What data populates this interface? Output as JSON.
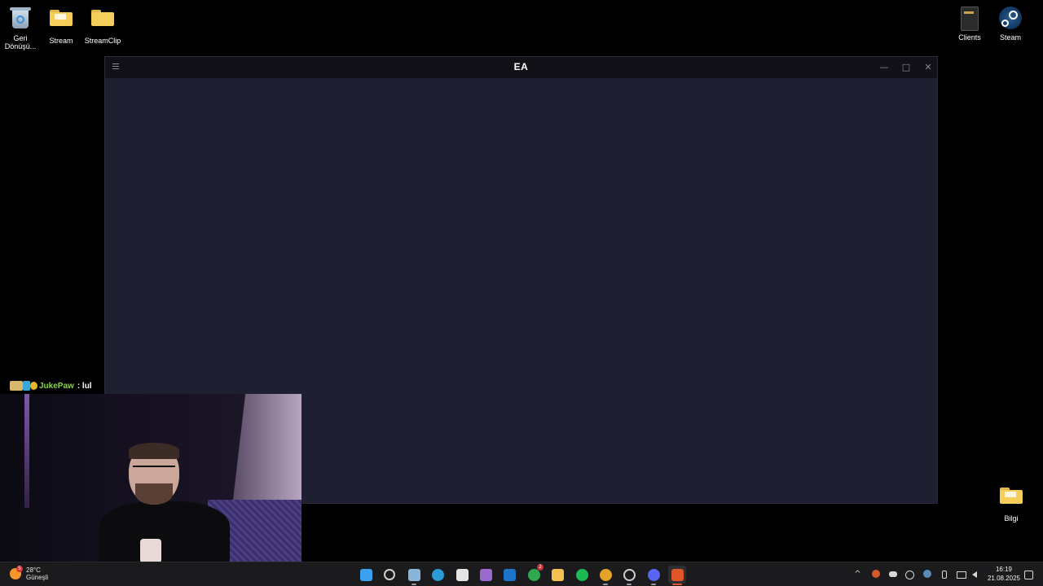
{
  "desktop": {
    "icons": [
      {
        "label": "Geri Dönüşü...",
        "icon": "recycle-bin-icon"
      },
      {
        "label": "Stream",
        "icon": "folder-icon"
      },
      {
        "label": "StreamClip",
        "icon": "folder-icon"
      },
      {
        "label": "Clients",
        "icon": "clients-icon"
      },
      {
        "label": "Steam",
        "icon": "steam-icon"
      },
      {
        "label": "Bilgi",
        "icon": "folder-icon"
      }
    ]
  },
  "window": {
    "title": "EA",
    "minimize_glyph": "—",
    "maximize_glyph": "□",
    "close_glyph": "✕",
    "background": "#1e1f31"
  },
  "chat": {
    "username": "JukePaw",
    "message": ": lul",
    "username_color": "#8bd34b"
  },
  "taskbar": {
    "weather": {
      "temperature": "28°C",
      "condition": "Güneşli",
      "badge": "5"
    },
    "apps": [
      {
        "name": "start",
        "icon": "windows-start-icon",
        "color": "#3aa0f0"
      },
      {
        "name": "search",
        "icon": "search-icon",
        "color": "#d0d0d0"
      },
      {
        "name": "app-settings",
        "icon": "gear-icon",
        "color": "#8ab4d8"
      },
      {
        "name": "edge",
        "icon": "edge-icon",
        "color": "#2a9bd7"
      },
      {
        "name": "store",
        "icon": "store-icon",
        "color": "#e5e5e5"
      },
      {
        "name": "copilot",
        "icon": "chat-app-icon",
        "color": "#9b6ad1"
      },
      {
        "name": "outlook",
        "icon": "outlook-icon",
        "color": "#1d73c9"
      },
      {
        "name": "xbox",
        "icon": "xbox-icon",
        "color": "#2fa84f",
        "badge": "2"
      },
      {
        "name": "explorer",
        "icon": "folder-icon",
        "color": "#f2c14e"
      },
      {
        "name": "spotify",
        "icon": "spotify-icon",
        "color": "#1db954"
      },
      {
        "name": "chrome",
        "icon": "chrome-icon",
        "color": "#e4a42b"
      },
      {
        "name": "clock-app",
        "icon": "clock-app-icon",
        "color": "#d0d0d0"
      },
      {
        "name": "discord",
        "icon": "discord-icon",
        "color": "#5865f2"
      },
      {
        "name": "ea",
        "icon": "ea-icon",
        "color": "#e0552b"
      }
    ],
    "clock": {
      "time": "16:19",
      "date": "21.08.2025"
    }
  }
}
